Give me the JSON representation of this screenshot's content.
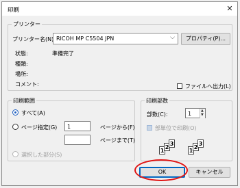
{
  "window": {
    "title": "印刷",
    "close_glyph": "✕"
  },
  "printer": {
    "group_label": "プリンター",
    "name_label": "プリンター名(N):",
    "name_value": "RICOH MP C5504 JPN",
    "properties_button": "プロパティ(P)...",
    "status_label": "状態:",
    "status_value": "準備完了",
    "type_label": "種類:",
    "location_label": "場所:",
    "comment_label": "コメント:",
    "print_to_file_label": "ファイルへ出力(L)",
    "print_to_file_checked": false
  },
  "range": {
    "group_label": "印刷範囲",
    "all_label": "すべて(A)",
    "pages_label": "ページ指定(G)",
    "from_value": "1",
    "from_label": "ページから(F)",
    "to_value": "",
    "to_label": "ページまで(T)",
    "selection_label": "選択した部分(S)",
    "selected": "all"
  },
  "copies": {
    "group_label": "印刷部数",
    "count_label": "部数(C):",
    "count_value": "1",
    "collate_label": "部単位で印刷(O)",
    "collate_checked": true,
    "collate_enabled": false,
    "collate_pages": [
      "1",
      "2",
      "3"
    ]
  },
  "footer": {
    "ok_button": "OK",
    "cancel_button": "キャンセル",
    "ok_highlight_color": "#e01414"
  },
  "colors": {
    "accent": "#1f5fbf",
    "focus": "#0067c0"
  }
}
